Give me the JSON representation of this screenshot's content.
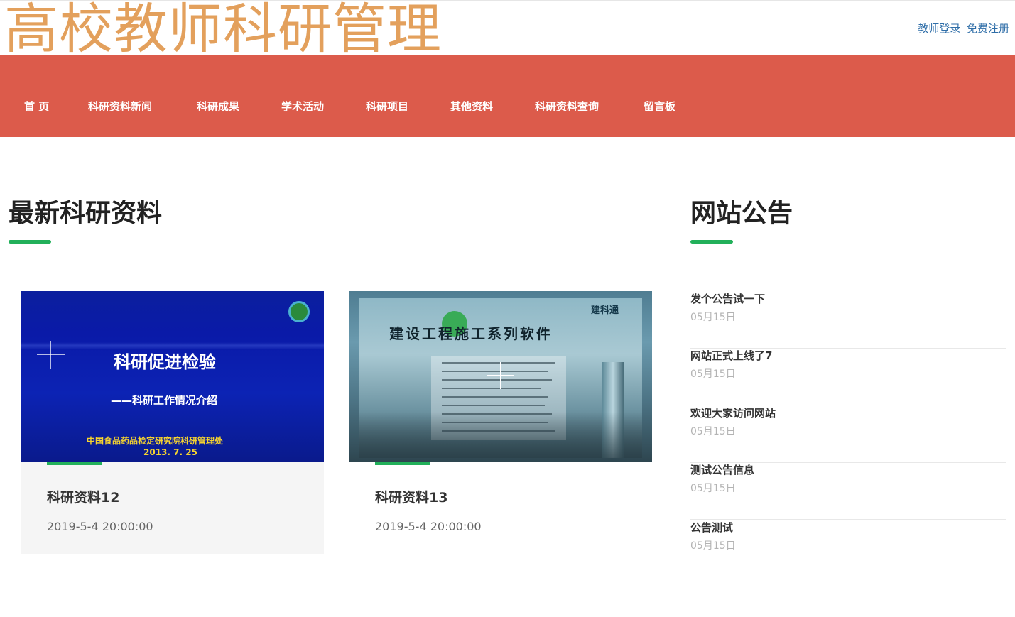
{
  "header": {
    "site_title": "高校教师科研管理",
    "login_link": "教师登录",
    "register_link": "免费注册"
  },
  "nav": {
    "items": [
      {
        "label": "首 页"
      },
      {
        "label": "科研资料新闻"
      },
      {
        "label": "科研成果"
      },
      {
        "label": "学术活动"
      },
      {
        "label": "科研项目"
      },
      {
        "label": "其他资料"
      },
      {
        "label": "科研资料查询"
      },
      {
        "label": "留言板"
      }
    ]
  },
  "latest": {
    "heading": "最新科研资料",
    "cards": [
      {
        "title": "科研资料12",
        "date": "2019-5-4 20:00:00",
        "image_text": {
          "headline": "科研促进检验",
          "subline": "——科研工作情况介绍",
          "org": "中国食品药品检定研究院科研管理处",
          "date": "2013. 7. 25"
        }
      },
      {
        "title": "科研资料13",
        "date": "2019-5-4 20:00:00",
        "image_text": {
          "headline": "建设工程施工系列软件",
          "brand": "建科通"
        }
      }
    ]
  },
  "notices": {
    "heading": "网站公告",
    "items": [
      {
        "title": "发个公告试一下",
        "date": "05月15日"
      },
      {
        "title": "网站正式上线了7",
        "date": "05月15日"
      },
      {
        "title": "欢迎大家访问网站",
        "date": "05月15日"
      },
      {
        "title": "测试公告信息",
        "date": "05月15日"
      },
      {
        "title": "公告测试",
        "date": "05月15日"
      }
    ]
  },
  "colors": {
    "nav_bg": "#dc5b4b",
    "title_orange": "#e3a05c",
    "accent_green": "#22b05a",
    "link_blue": "#2f6ea8"
  }
}
